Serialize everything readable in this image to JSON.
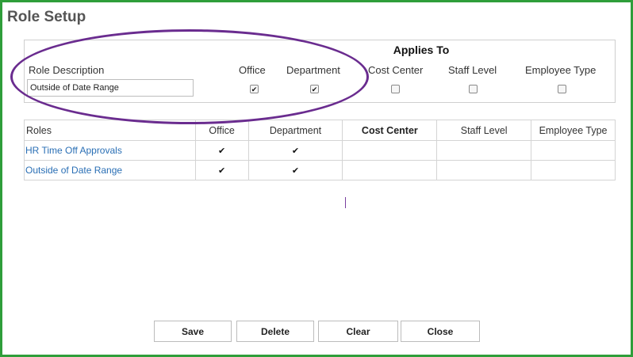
{
  "window": {
    "title": "Role Setup"
  },
  "setup": {
    "applies_to_label": "Applies To",
    "description_label": "Role Description",
    "description_value": "Outside of Date Range",
    "columns": [
      "Office",
      "Department",
      "Cost Center",
      "Staff Level",
      "Employee Type"
    ],
    "checks": [
      true,
      true,
      false,
      false,
      false
    ]
  },
  "roles_table": {
    "headers": [
      "Roles",
      "Office",
      "Department",
      "Cost Center",
      "Staff Level",
      "Employee Type"
    ],
    "rows": [
      {
        "name": "HR Time Off Approvals",
        "office": "✔",
        "department": "✔",
        "cost_center": "",
        "staff_level": "",
        "employee_type": ""
      },
      {
        "name": "Outside of Date Range",
        "office": "✔",
        "department": "✔",
        "cost_center": "",
        "staff_level": "",
        "employee_type": ""
      }
    ]
  },
  "buttons": {
    "save": "Save",
    "delete": "Delete",
    "clear": "Clear",
    "close": "Close"
  },
  "colors": {
    "frame_border": "#2f9e3a",
    "annotation_oval": "#6a2c8f",
    "link": "#2a6fb5"
  }
}
